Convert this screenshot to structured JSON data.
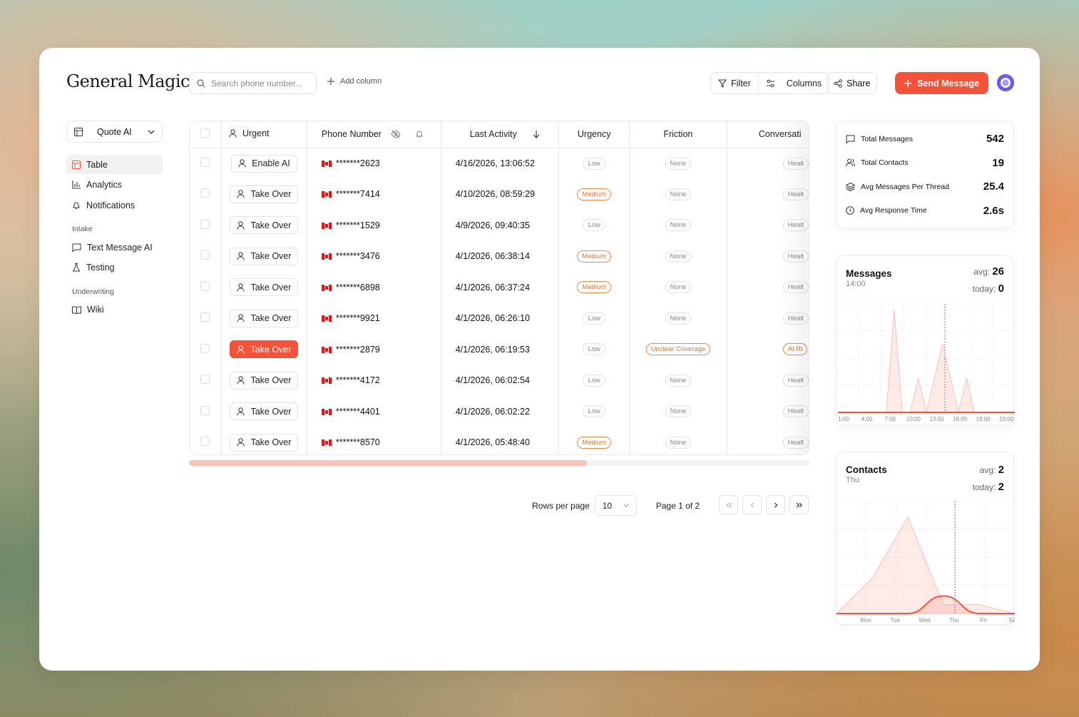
{
  "app": {
    "logo": "General Magic"
  },
  "search": {
    "placeholder": "Search phone number..."
  },
  "add_column": "Add column",
  "toolbar": {
    "filter": "Filter",
    "columns": "Columns",
    "share": "Share",
    "send": "Send Message"
  },
  "workspace": {
    "name": "Quote AI"
  },
  "nav": {
    "table": "Table",
    "analytics": "Analytics",
    "notifications": "Notifications",
    "intake": "Intake",
    "text_message_ai": "Text Message AI",
    "testing": "Testing",
    "underwriting": "Underwriting",
    "wiki": "Wiki"
  },
  "table": {
    "headers": {
      "urgent": "Urgent",
      "phone": "Phone Number",
      "activity": "Last Activity",
      "urgency": "Urgency",
      "friction": "Friction",
      "conversation": "Conversati"
    },
    "rows": [
      {
        "action": "Enable AI",
        "phone": "*******2623",
        "activity": "4/16/2026, 13:06:52",
        "urgency": "Low",
        "friction": "None",
        "conv": "Healt"
      },
      {
        "action": "Take Over",
        "phone": "*******7414",
        "activity": "4/10/2026, 08:59:29",
        "urgency": "Medium",
        "friction": "None",
        "conv": "Healt"
      },
      {
        "action": "Take Over",
        "phone": "*******1529",
        "activity": "4/9/2026, 09:40:35",
        "urgency": "Low",
        "friction": "None",
        "conv": "Healt"
      },
      {
        "action": "Take Over",
        "phone": "*******3476",
        "activity": "4/1/2026, 06:38:14",
        "urgency": "Medium",
        "friction": "None",
        "conv": "Healt"
      },
      {
        "action": "Take Over",
        "phone": "*******6898",
        "activity": "4/1/2026, 06:37:24",
        "urgency": "Medium",
        "friction": "None",
        "conv": "Healt"
      },
      {
        "action": "Take Over",
        "phone": "*******9921",
        "activity": "4/1/2026, 06:26:10",
        "urgency": "Low",
        "friction": "None",
        "conv": "Healt"
      },
      {
        "action": "Take Over",
        "phone": "*******2879",
        "activity": "4/1/2026, 06:19:53",
        "urgency": "Low",
        "friction": "Unclear Coverage",
        "conv": "At Ri"
      },
      {
        "action": "Take Over",
        "phone": "*******4172",
        "activity": "4/1/2026, 06:02:54",
        "urgency": "Low",
        "friction": "None",
        "conv": "Healt"
      },
      {
        "action": "Take Over",
        "phone": "*******4401",
        "activity": "4/1/2026, 06:02:22",
        "urgency": "Low",
        "friction": "None",
        "conv": "Healt"
      },
      {
        "action": "Take Over",
        "phone": "*******8570",
        "activity": "4/1/2026, 05:48:40",
        "urgency": "Medium",
        "friction": "None",
        "conv": "Healt"
      }
    ]
  },
  "pagination": {
    "rows_label": "Rows per page",
    "rows_value": "10",
    "page_label": "Page 1 of 2"
  },
  "stats": [
    {
      "label": "Total Messages",
      "value": "542",
      "icon": "message-icon"
    },
    {
      "label": "Total Contacts",
      "value": "19",
      "icon": "users-icon"
    },
    {
      "label": "Avg Messages Per Thread",
      "value": "25.4",
      "icon": "layers-icon"
    },
    {
      "label": "Avg Response Time",
      "value": "2.6s",
      "icon": "clock-icon"
    }
  ],
  "messages_chart": {
    "title": "Messages",
    "subtitle": "14:00",
    "avg_label": "avg:",
    "avg_value": "26",
    "today_label": "today:",
    "today_value": "0"
  },
  "contacts_chart": {
    "title": "Contacts",
    "subtitle": "Thu",
    "avg_label": "avg:",
    "avg_value": "2",
    "today_label": "today:",
    "today_value": "2"
  },
  "chart_data": [
    {
      "type": "area",
      "x": [
        "1:00",
        "2:00",
        "3:00",
        "4:00",
        "5:00",
        "6:00",
        "7:00",
        "8:00",
        "9:00",
        "10:00",
        "11:00",
        "12:00",
        "13:00",
        "14:00",
        "15:00",
        "16:00",
        "17:00",
        "18:00",
        "19:00",
        "20:00",
        "21:00",
        "22:00",
        "23:00"
      ],
      "tick_labels": [
        "1:00",
        "4:00",
        "7:00",
        "10:00",
        "13:00",
        "16:00",
        "19:00",
        "23:00"
      ],
      "series": [
        {
          "values": [
            0,
            0,
            0,
            0,
            0,
            0,
            0,
            3,
            0,
            0,
            1,
            0,
            1,
            2,
            1,
            0,
            1,
            0,
            0,
            0,
            0,
            0,
            0
          ]
        },
        {
          "values": [
            0,
            0,
            0,
            0,
            0,
            0,
            0,
            0,
            0,
            0,
            0,
            0,
            0,
            0,
            0,
            0,
            0,
            0,
            0,
            0,
            0,
            0,
            0
          ]
        }
      ],
      "ylim": [
        0,
        3
      ],
      "grid": true
    },
    {
      "type": "area",
      "x": [
        "Mon",
        "Tue",
        "Wed",
        "Thu",
        "Fri",
        "Sat"
      ],
      "tick_labels": [
        "Mon",
        "Tue",
        "Wed",
        "Thu",
        "Fri",
        "Sat"
      ],
      "series": [
        {
          "values": [
            0,
            4,
            11,
            1,
            1,
            0
          ]
        },
        {
          "values": [
            0,
            0,
            0,
            2,
            0,
            0
          ]
        }
      ],
      "ylim": [
        0,
        12
      ],
      "grid": true
    }
  ],
  "colors": {
    "accent": "#f4533a",
    "accent_light": "#f9c2b8",
    "pill_medium": "#e8742b"
  }
}
